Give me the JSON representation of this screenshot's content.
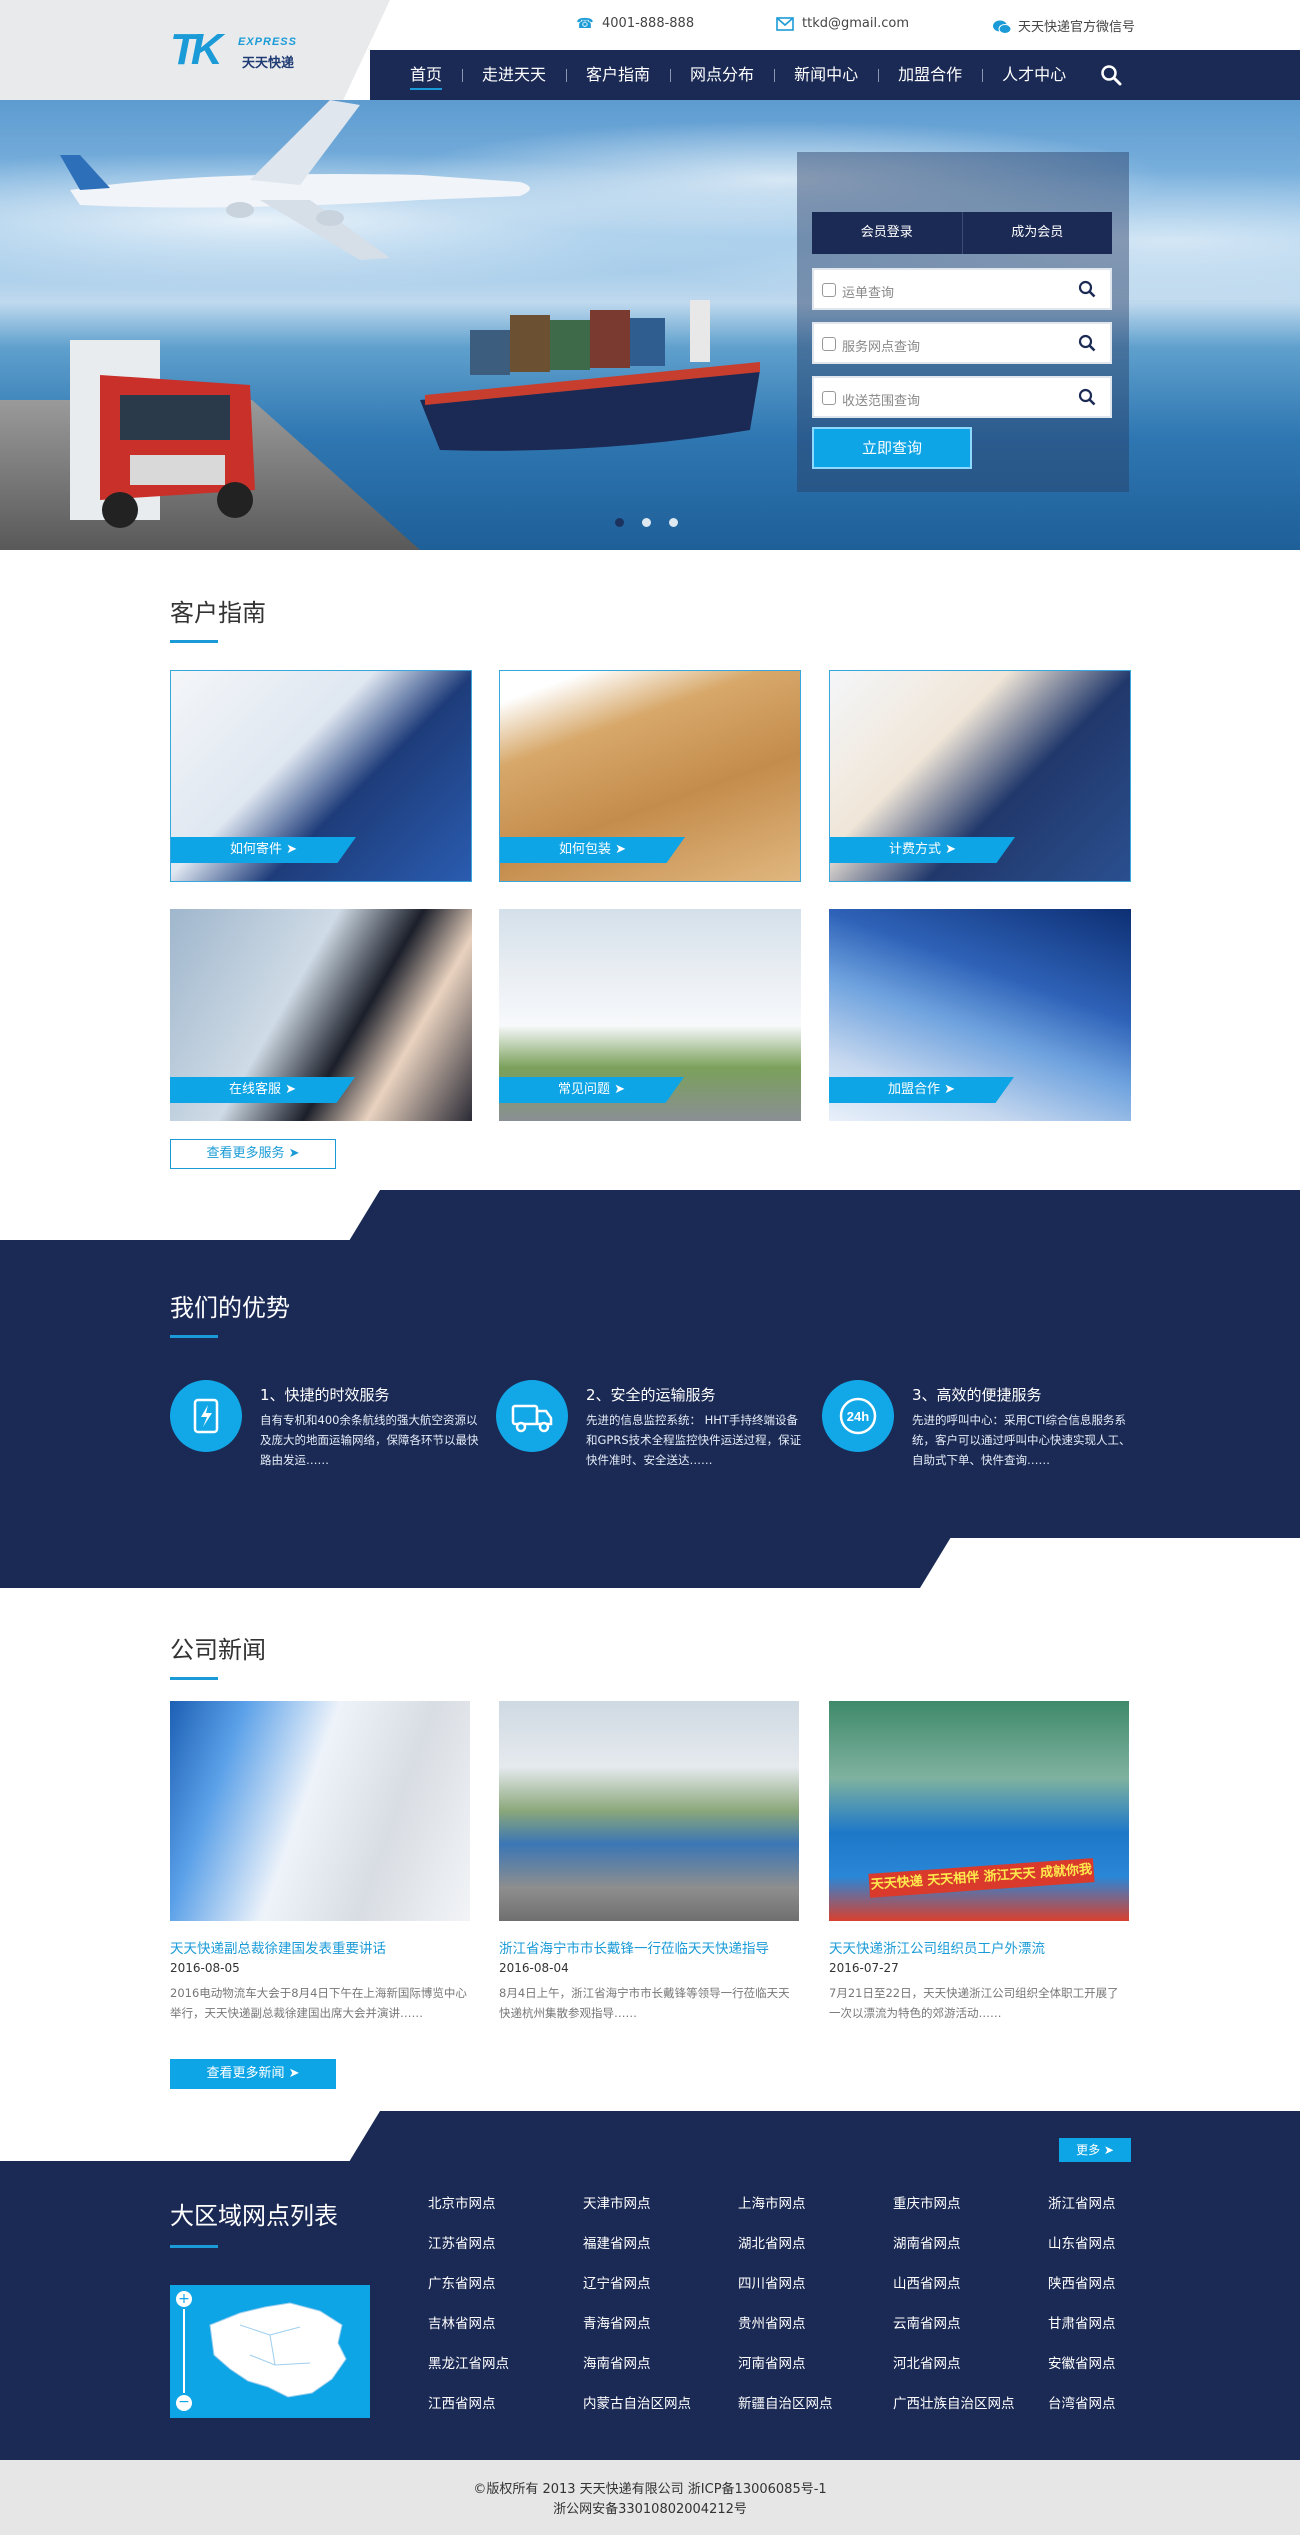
{
  "logo": {
    "mark": "TK",
    "en": "EXPRESS",
    "cn": "天天快递"
  },
  "contacts": {
    "phone": "4001-888-888",
    "email": "ttkd@gmail.com",
    "wechat": "天天快递官方微信号"
  },
  "nav": {
    "items": [
      "首页",
      "走进天天",
      "客户指南",
      "网点分布",
      "新闻中心",
      "加盟合作",
      "人才中心"
    ],
    "active_index": 0
  },
  "hero": {
    "tabs": [
      "会员登录",
      "成为会员"
    ],
    "inputs": [
      {
        "placeholder": "运单查询"
      },
      {
        "placeholder": "服务网点查询"
      },
      {
        "placeholder": "收送范围查询"
      }
    ],
    "submit": "立即查询",
    "slides": 3,
    "active_slide": 0
  },
  "guide": {
    "title": "客户指南",
    "cards": [
      "如何寄件 ➤",
      "如何包装 ➤",
      "计费方式 ➤",
      "在线客服 ➤",
      "常见问题 ➤",
      "加盟合作 ➤"
    ],
    "more": "查看更多服务 ➤"
  },
  "advantages": {
    "title": "我们的优势",
    "items": [
      {
        "heading": "1、快捷的时效服务",
        "text": "自有专机和400余条航线的强大航空资源以及庞大的地面运输网络，保障各环节以最快路由发运……"
      },
      {
        "heading": "2、安全的运输服务",
        "text": "先进的信息监控系统： HHT手持终端设备和GPRS技术全程监控快件运送过程，保证快件准时、安全送达……"
      },
      {
        "heading": "3、高效的便捷服务",
        "text": "先进的呼叫中心：采用CTI综合信息服务系统，客户可以通过呼叫中心快速实现人工、自助式下单、快件查询……"
      }
    ]
  },
  "news": {
    "title": "公司新闻",
    "items": [
      {
        "title": "天天快递副总裁徐建国发表重要讲话",
        "date": "2016-08-05",
        "summary": "2016电动物流车大会于8月4日下午在上海新国际博览中心举行，天天快递副总裁徐建国出席大会并演讲……"
      },
      {
        "title": "浙江省海宁市市长戴锋一行莅临天天快递指导",
        "date": "2016-08-04",
        "summary": "8月4日上午，浙江省海宁市市长戴锋等领导一行莅临天天快递杭州集散参观指导……"
      },
      {
        "title": "天天快递浙江公司组织员工户外漂流",
        "date": "2016-07-27",
        "summary": "7月21日至22日，天天快递浙江公司组织全体职工开展了一次以漂流为特色的郊游活动……"
      }
    ],
    "more": "查看更多新闻 ➤",
    "banner_text": "天天快递 天天相伴 浙江天天 成就你我"
  },
  "regions": {
    "title": "大区域网点列表",
    "more": "更多 ➤",
    "items": [
      "北京市网点",
      "天津市网点",
      "上海市网点",
      "重庆市网点",
      "浙江省网点",
      "江苏省网点",
      "福建省网点",
      "湖北省网点",
      "湖南省网点",
      "山东省网点",
      "广东省网点",
      "辽宁省网点",
      "四川省网点",
      "山西省网点",
      "陕西省网点",
      "吉林省网点",
      "青海省网点",
      "贵州省网点",
      "云南省网点",
      "甘肃省网点",
      "黑龙江省网点",
      "海南省网点",
      "河南省网点",
      "河北省网点",
      "安徽省网点",
      "江西省网点",
      "内蒙古自治区网点",
      "新疆自治区网点",
      "广西壮族自治区网点",
      "台湾省网点"
    ]
  },
  "footer": {
    "line1": "©版权所有 2013 天天快递有限公司 浙ICP备13006085号-1",
    "line2": "浙公网安备33010802004212号"
  },
  "colors": {
    "navy": "#1b2a55",
    "accent": "#1a9bd7",
    "button": "#0ea5e6"
  }
}
